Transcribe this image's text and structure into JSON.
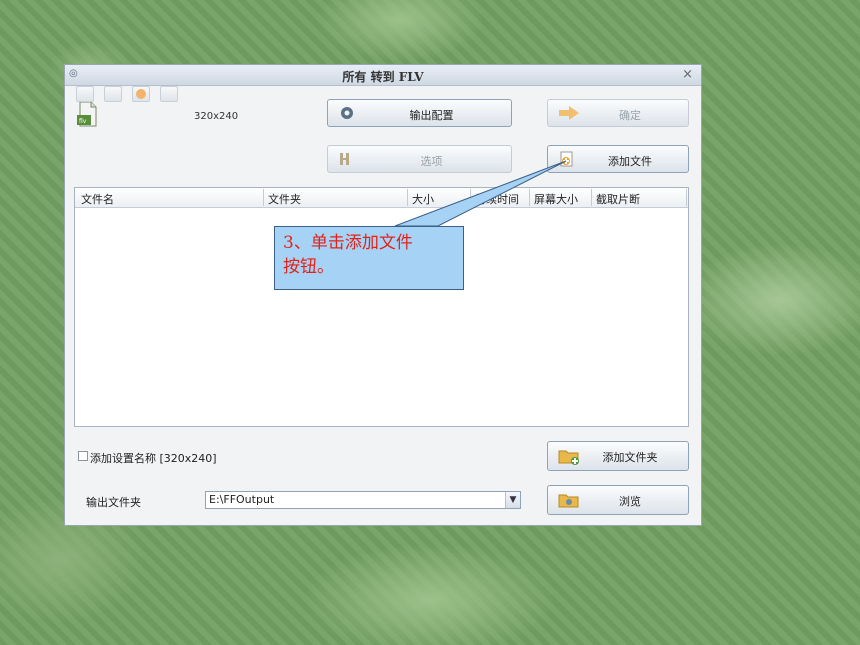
{
  "window": {
    "title": "所有 转到 FLV",
    "close_symbol": "×",
    "preset_label": "320x240"
  },
  "buttons": {
    "output_config": "输出配置",
    "confirm": "确定",
    "options": "选项",
    "add_file": "添加文件",
    "add_folder": "添加文件夹",
    "browse": "浏览"
  },
  "file_list": {
    "columns": [
      "文件名",
      "文件夹",
      "大小",
      "持续时间",
      "屏幕大小",
      "截取片断"
    ],
    "rows": []
  },
  "callout": {
    "line1": "3、单击添加文件",
    "line2": "按钮。"
  },
  "settings": {
    "add_setting_name_label": "添加设置名称 [320x240]",
    "add_setting_name_checked": false,
    "output_folder_label": "输出文件夹",
    "output_folder_value": "E:\\FFOutput"
  },
  "colors": {
    "callout_bg": "#a6d3f5",
    "callout_text": "#e2221a",
    "background": "#6f9a5f"
  },
  "icons": {
    "flv_file": "flv-file-icon",
    "output_config": "gear-icon",
    "confirm": "arrow-right-icon",
    "options": "options-icon",
    "add_file": "add-file-icon",
    "add_folder": "add-folder-icon",
    "browse": "folder-browse-icon"
  }
}
